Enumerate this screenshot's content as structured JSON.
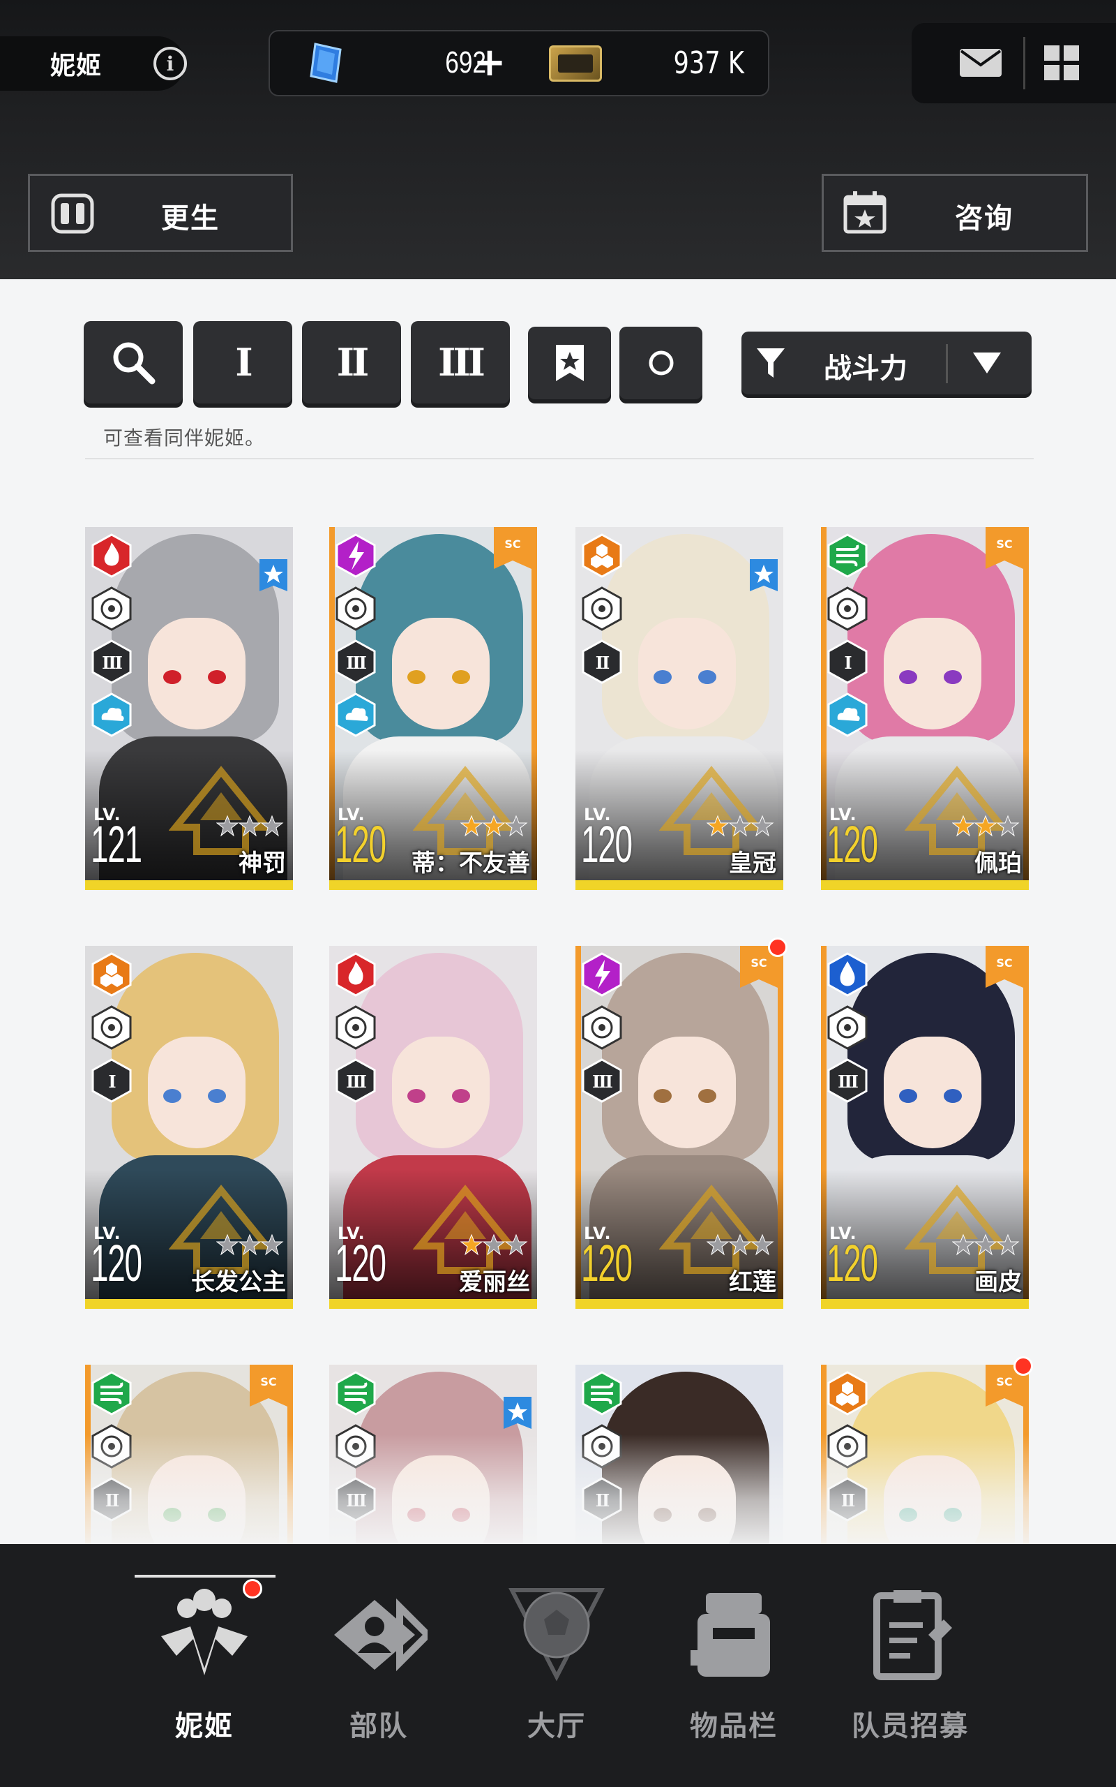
{
  "header": {
    "page_title": "妮姬",
    "info_icon": "info-icon",
    "gems": "692",
    "gems_add": "+",
    "credits": "937 K",
    "mail_icon": "mail-icon",
    "menu_icon": "grid-menu-icon"
  },
  "actions": {
    "rebirth_label": "更生",
    "consult_label": "咨询"
  },
  "filters": {
    "search_icon": "search-icon",
    "burst_1": "I",
    "burst_2": "II",
    "burst_3": "III",
    "favorite_icon": "bookmark-star-icon",
    "circle_icon": "circle-icon",
    "sort_label": "战斗力",
    "hint": "可查看同伴妮姬。"
  },
  "nikke_cards": [
    {
      "name": "神罚",
      "level": "121",
      "lv_label": "LV.",
      "element": "fire",
      "element_color": "#d8262a",
      "burst": "III",
      "weapon": "SR",
      "code": "wind",
      "favorite": true,
      "sc": false,
      "stars": 0,
      "orange": false,
      "gold_level": false
    },
    {
      "name": "蒂：不友善",
      "level": "120",
      "lv_label": "LV.",
      "element": "electric",
      "element_color": "#b320c8",
      "burst": "III",
      "weapon": "SR",
      "code": "wind",
      "favorite": false,
      "sc": true,
      "stars": 2,
      "orange": true,
      "gold_level": true
    },
    {
      "name": "皇冠",
      "level": "120",
      "lv_label": "LV.",
      "element": "iron",
      "element_color": "#e87a16",
      "burst": "II",
      "weapon": "MG",
      "code": "",
      "favorite": true,
      "sc": false,
      "stars": 1,
      "orange": false,
      "gold_level": false
    },
    {
      "name": "佩珀",
      "level": "120",
      "lv_label": "LV.",
      "element": "wind",
      "element_color": "#1fa84a",
      "burst": "I",
      "weapon": "SMG",
      "code": "wind",
      "favorite": false,
      "sc": true,
      "stars": 2,
      "orange": true,
      "gold_level": true
    },
    {
      "name": "长发公主",
      "level": "120",
      "lv_label": "LV.",
      "element": "iron",
      "element_color": "#e87a16",
      "burst": "I",
      "weapon": "RL",
      "code": "",
      "favorite": false,
      "sc": false,
      "stars": 0,
      "orange": false,
      "gold_level": false
    },
    {
      "name": "爱丽丝",
      "level": "120",
      "lv_label": "LV.",
      "element": "fire",
      "element_color": "#d8262a",
      "burst": "III",
      "weapon": "SR",
      "code": "",
      "favorite": false,
      "sc": false,
      "stars": 1,
      "orange": false,
      "gold_level": false
    },
    {
      "name": "红莲",
      "level": "120",
      "lv_label": "LV.",
      "element": "electric",
      "element_color": "#b320c8",
      "burst": "III",
      "weapon": "AR",
      "code": "",
      "favorite": false,
      "sc": true,
      "stars": 0,
      "orange": true,
      "gold_level": true,
      "notify": true
    },
    {
      "name": "画皮",
      "level": "120",
      "lv_label": "LV.",
      "element": "water",
      "element_color": "#1c5fd0",
      "burst": "III",
      "weapon": "AR",
      "code": "",
      "favorite": false,
      "sc": true,
      "stars": 0,
      "orange": true,
      "gold_level": true
    },
    {
      "name": "",
      "level": "",
      "lv_label": "",
      "element": "wind",
      "element_color": "#1fa84a",
      "burst": "II",
      "weapon": "AR",
      "code": "",
      "favorite": false,
      "sc": true,
      "stars": 0,
      "orange": true,
      "gold_level": true
    },
    {
      "name": "",
      "level": "",
      "lv_label": "",
      "element": "wind",
      "element_color": "#1fa84a",
      "burst": "III",
      "weapon": "RL",
      "code": "",
      "favorite": true,
      "sc": false,
      "stars": 0,
      "orange": false,
      "gold_level": false
    },
    {
      "name": "",
      "level": "",
      "lv_label": "",
      "element": "wind",
      "element_color": "#1fa84a",
      "burst": "II",
      "weapon": "SMG",
      "code": "",
      "favorite": false,
      "sc": false,
      "stars": 0,
      "orange": false,
      "gold_level": false
    },
    {
      "name": "",
      "level": "",
      "lv_label": "",
      "element": "iron",
      "element_color": "#e87a16",
      "burst": "II",
      "weapon": "AR",
      "code": "",
      "favorite": false,
      "sc": true,
      "stars": 0,
      "orange": true,
      "gold_level": true,
      "notify": true
    }
  ],
  "bottom_nav": [
    {
      "label": "妮姬",
      "icon": "nikke-icon",
      "active": true,
      "notify": true
    },
    {
      "label": "部队",
      "icon": "squad-icon",
      "active": false,
      "notify": false
    },
    {
      "label": "大厅",
      "icon": "lobby-icon",
      "active": false,
      "notify": false
    },
    {
      "label": "物品栏",
      "icon": "inventory-icon",
      "active": false,
      "notify": false
    },
    {
      "label": "队员招募",
      "icon": "recruit-icon",
      "active": false,
      "notify": false
    }
  ],
  "colors": {
    "accent_yellow": "#f0d428",
    "accent_orange": "#f39a2b",
    "notify_red": "#ff3322",
    "dark": "#1c1d1f"
  }
}
